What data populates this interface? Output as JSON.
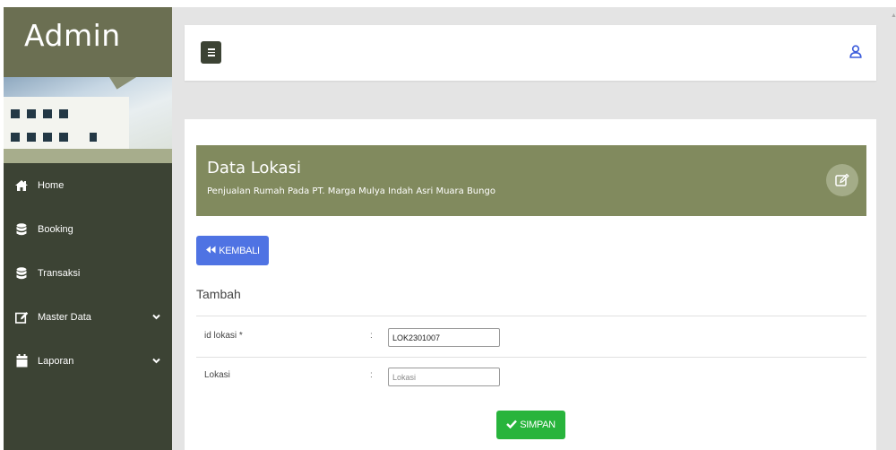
{
  "sidebar": {
    "brand": "Admin",
    "items": [
      {
        "label": "Home",
        "icon": "home-icon",
        "has_submenu": false
      },
      {
        "label": "Booking",
        "icon": "database-icon",
        "has_submenu": false
      },
      {
        "label": "Transaksi",
        "icon": "database-icon",
        "has_submenu": false
      },
      {
        "label": "Master Data",
        "icon": "edit-icon",
        "has_submenu": true
      },
      {
        "label": "Laporan",
        "icon": "calendar-icon",
        "has_submenu": true
      }
    ]
  },
  "topbar": {
    "menu_icon": "hamburger-icon",
    "user_icon": "user-icon"
  },
  "page": {
    "title": "Data Lokasi",
    "subtitle": "Penjualan Rumah Pada PT. Marga Mulya Indah Asri Muara Bungo",
    "header_icon": "edit-icon"
  },
  "back_button": {
    "label": "KEMBALI",
    "icon": "backward-icon"
  },
  "form": {
    "title": "Tambah",
    "fields": [
      {
        "label": "id lokasi *",
        "separator": ":",
        "value": "LOK2301007",
        "placeholder": ""
      },
      {
        "label": "Lokasi",
        "separator": ":",
        "value": "",
        "placeholder": "Lokasi"
      }
    ],
    "submit": {
      "label": "SIMPAN",
      "icon": "check-icon"
    }
  },
  "colors": {
    "sidebar_bg": "#3c4334",
    "header_bg": "#818a5e",
    "back_button": "#4f73e3",
    "save_button": "#28b43c",
    "user_icon": "#3b5bdb"
  }
}
